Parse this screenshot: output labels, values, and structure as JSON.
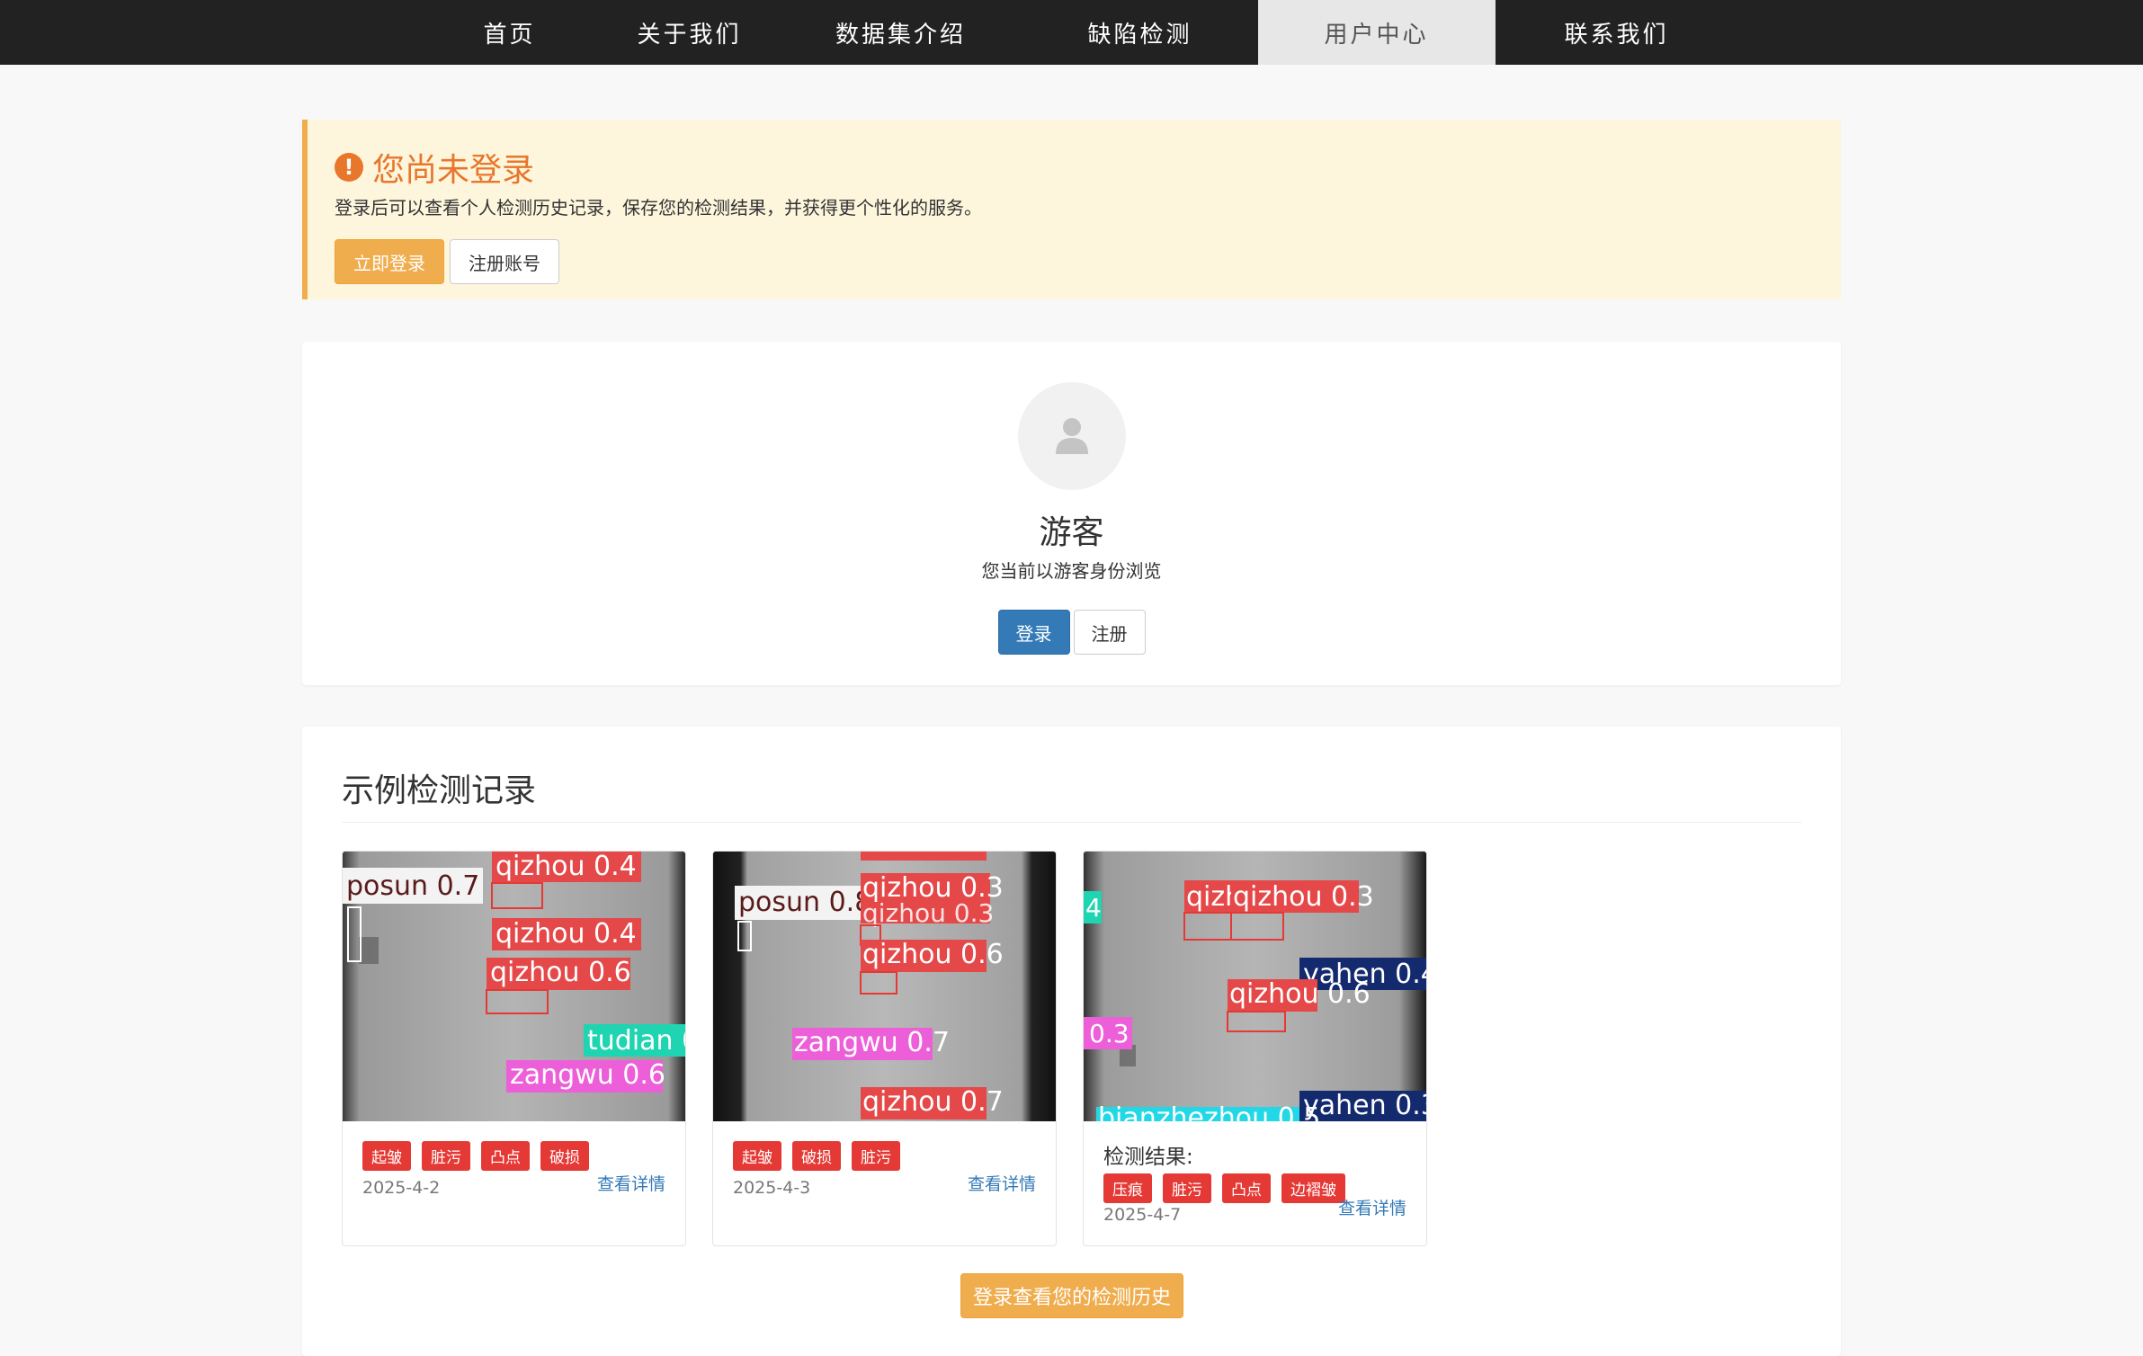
{
  "nav": {
    "items": [
      {
        "label": "首页",
        "active": false
      },
      {
        "label": "关于我们",
        "active": false
      },
      {
        "label": "数据集介绍",
        "active": false
      },
      {
        "label": "缺陷检测",
        "active": false
      },
      {
        "label": "用户中心",
        "active": true
      },
      {
        "label": "联系我们",
        "active": false
      }
    ]
  },
  "alert": {
    "title": "您尚未登录",
    "description": "登录后可以查看个人检测历史记录，保存您的检测结果，并获得更个性化的服务。",
    "login_label": "立即登录",
    "register_label": "注册账号",
    "icon": "exclamation-circle-icon"
  },
  "profile": {
    "name": "游客",
    "subtitle": "您当前以游客身份浏览",
    "login_label": "登录",
    "register_label": "注册",
    "avatar_icon": "user-icon"
  },
  "records": {
    "title": "示例检测记录",
    "history_button": "登录查看您的检测历史",
    "items": [
      {
        "tags": [
          "起皱",
          "脏污",
          "凸点",
          "破损"
        ],
        "date": "2025-4-2",
        "link": "查看详情",
        "detections": [
          "posun 0.7",
          "qizhou 0.4",
          "qizhou 0.4",
          "qizhou 0.6",
          "tudian 0",
          "zangwu 0.6"
        ]
      },
      {
        "tags": [
          "起皱",
          "破损",
          "脏污"
        ],
        "date": "2025-4-3",
        "link": "查看详情",
        "detections": [
          "posun 0.8",
          "qizhou 0.3",
          "qizhou 0.3",
          "qizhou 0.6",
          "zangwu 0.7",
          "qizhou 0.7"
        ]
      },
      {
        "result_label": "检测结果:",
        "tags": [
          "压痕",
          "脏污",
          "凸点",
          "边褶皱"
        ],
        "date": "2025-4-7",
        "link": "查看详情",
        "detections": [
          "qizh",
          "qizhou 0.3",
          "4",
          "yahen 0.4",
          "qizhou 0.6",
          "0.3",
          "yahen 0.3",
          "bianzhezhou 0.5"
        ]
      }
    ]
  },
  "colors": {
    "nav_bg": "#222222",
    "warning": "#f0ad4e",
    "primary": "#337ab7",
    "tag": "#e53935",
    "alert_title": "#e8762b"
  }
}
